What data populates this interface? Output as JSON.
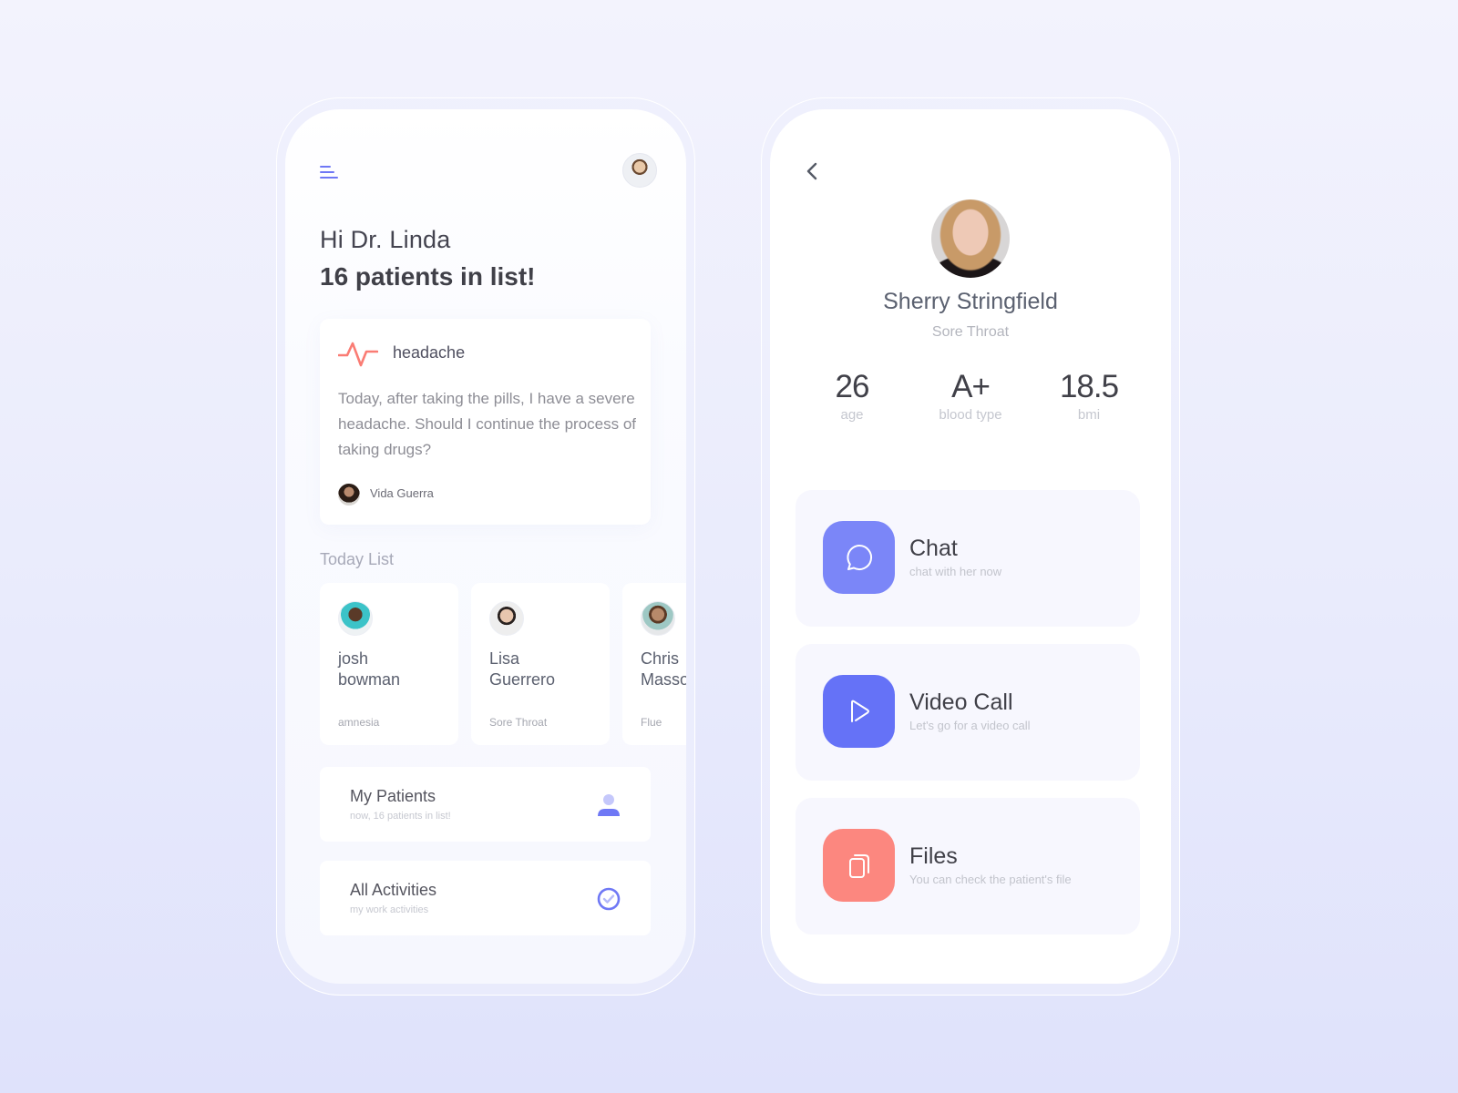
{
  "colors": {
    "accent": "#6f78f5",
    "chat": "#7b86f8",
    "video": "#6572f7",
    "files": "#fc877f",
    "pulse": "#fa7c74"
  },
  "home": {
    "menu_icon": "hamburger-menu-icon",
    "greeting": "Hi Dr. Linda",
    "patients_count": "16 patients in list!",
    "note": {
      "icon": "pulse-icon",
      "title": "headache",
      "body": "Today, after taking the pills, I have a severe headache. Should I continue the process of taking drugs?",
      "author": "Vida Guerra"
    },
    "today_list": {
      "label": "Today List",
      "patients": [
        {
          "name": "josh\nbowman",
          "condition": "amnesia"
        },
        {
          "name": "Lisa\nGuerrero",
          "condition": "Sore Throat"
        },
        {
          "name": "Chris\nMasson",
          "condition": "Flue"
        }
      ]
    },
    "menu": [
      {
        "title": "My Patients",
        "subtitle": "now, 16 patients in list!",
        "icon": "user-icon"
      },
      {
        "title": "All Activities",
        "subtitle": "my work activities",
        "icon": "check-circle-icon"
      }
    ]
  },
  "profile": {
    "back_icon": "chevron-left-icon",
    "name": "Sherry Stringfield",
    "condition": "Sore Throat",
    "stats": [
      {
        "value": "26",
        "label": "age"
      },
      {
        "value": "A+",
        "label": "blood type"
      },
      {
        "value": "18.5",
        "label": "bmi"
      }
    ],
    "actions": [
      {
        "title": "Chat",
        "subtitle": "chat with her now",
        "icon": "chat-bubble-icon"
      },
      {
        "title": "Video Call",
        "subtitle": "Let's go for a video call",
        "icon": "play-icon"
      },
      {
        "title": "Files",
        "subtitle": "You can check the patient's file",
        "icon": "files-icon"
      }
    ]
  }
}
